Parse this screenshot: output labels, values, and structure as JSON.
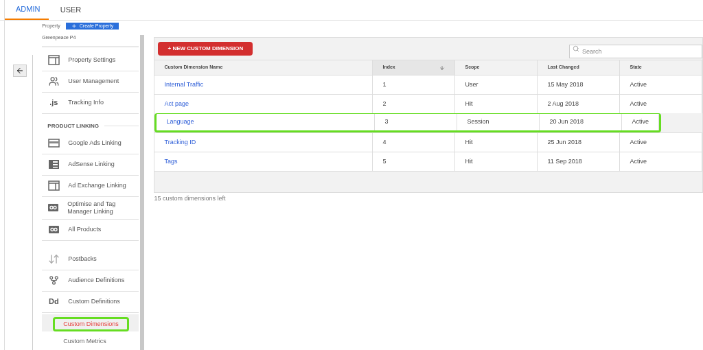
{
  "tabs": [
    {
      "label": "ADMIN",
      "selected": true
    },
    {
      "label": "USER",
      "selected": false
    }
  ],
  "property": {
    "label": "Property",
    "button": "Create Property",
    "name": "Greenpeace P4"
  },
  "sidebar": {
    "items": [
      {
        "kind": "item",
        "label": "Property Settings"
      },
      {
        "kind": "item",
        "label": "User Management"
      },
      {
        "kind": "item",
        "label": "Tracking Info",
        "glyph": ".js"
      },
      {
        "kind": "section",
        "label": "PRODUCT LINKING"
      },
      {
        "kind": "item",
        "label": "Google Ads Linking"
      },
      {
        "kind": "item",
        "label": "AdSense Linking"
      },
      {
        "kind": "item",
        "label": "Ad Exchange Linking"
      },
      {
        "kind": "item",
        "label": "Optimise and Tag Manager Linking"
      },
      {
        "kind": "item",
        "label": "All Products"
      },
      {
        "kind": "gap"
      },
      {
        "kind": "item",
        "label": "Postbacks"
      },
      {
        "kind": "item",
        "label": "Audience Definitions"
      },
      {
        "kind": "item",
        "label": "Custom Definitions",
        "glyph": "Dd",
        "children": [
          {
            "label": "Custom Dimensions",
            "selected": true,
            "highlighted": true
          },
          {
            "label": "Custom Metrics",
            "selected": false,
            "highlighted": false
          }
        ]
      }
    ]
  },
  "toolbar": {
    "new_button": "+ NEW CUSTOM DIMENSION",
    "search": {
      "placeholder": "Search"
    }
  },
  "table": {
    "columns": [
      {
        "label": "Custom Dimension Name",
        "sorted": false
      },
      {
        "label": "Index",
        "sorted": true
      },
      {
        "label": "Scope",
        "sorted": false
      },
      {
        "label": "Last Changed",
        "sorted": false
      },
      {
        "label": "State",
        "sorted": false
      }
    ],
    "rows": [
      {
        "cells": [
          "Internal Traffic",
          "1",
          "User",
          "15 May 2018",
          "Active"
        ],
        "highlighted": false
      },
      {
        "cells": [
          "Act page",
          "2",
          "Hit",
          "2 Aug 2018",
          "Active"
        ],
        "highlighted": false
      },
      {
        "cells": [
          "Language",
          "3",
          "Session",
          "20 Jun 2018",
          "Active"
        ],
        "highlighted": true
      },
      {
        "cells": [
          "Tracking ID",
          "4",
          "Hit",
          "25 Jun 2018",
          "Active"
        ],
        "highlighted": false
      },
      {
        "cells": [
          "Tags",
          "5",
          "Hit",
          "11 Sep 2018",
          "Active"
        ],
        "highlighted": false
      }
    ]
  },
  "footer": "15 custom dimensions left"
}
